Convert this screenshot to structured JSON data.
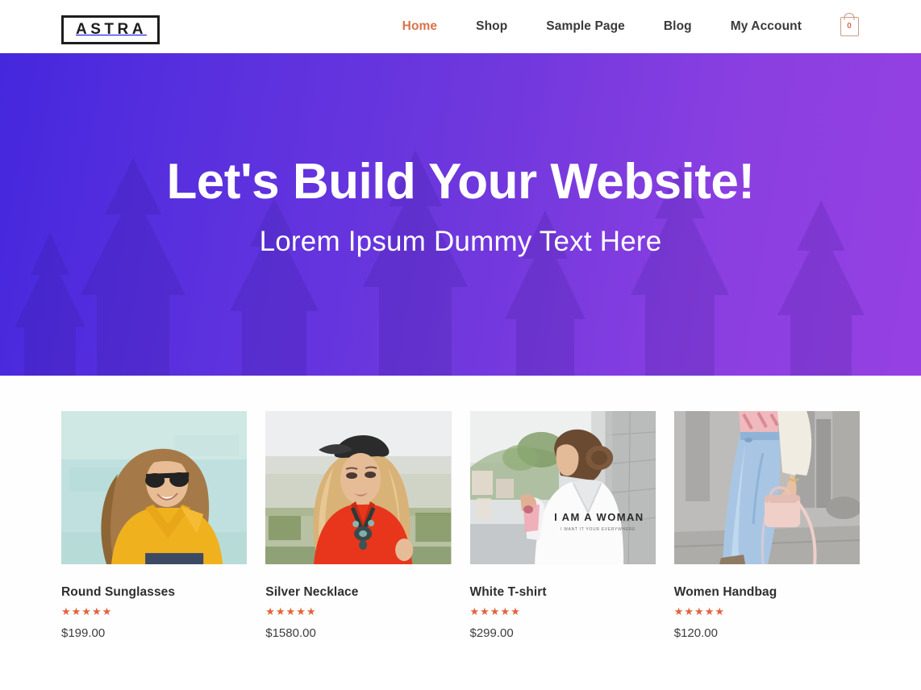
{
  "header": {
    "logo_text": "ASTRA",
    "nav": [
      {
        "label": "Home",
        "active": true
      },
      {
        "label": "Shop",
        "active": false
      },
      {
        "label": "Sample Page",
        "active": false
      },
      {
        "label": "Blog",
        "active": false
      },
      {
        "label": "My Account",
        "active": false
      }
    ],
    "cart": {
      "icon": "shopping-bag-icon",
      "count": "0",
      "color": "#cc9a85"
    }
  },
  "hero": {
    "title": "Let's Build Your Website!",
    "subtitle": "Lorem Ipsum Dummy Text Here",
    "gradient_from": "#4527dd",
    "gradient_to": "#9540e2",
    "background_motif": "pine-tree-silhouettes"
  },
  "products": [
    {
      "name": "Round Sunglasses",
      "stars": "★★★★★",
      "rating": 5,
      "price": "$199.00",
      "image_alt": "woman in yellow polo shirt wearing sunglasses against teal wall"
    },
    {
      "name": "Silver Necklace",
      "stars": "★★★★★",
      "rating": 5,
      "price": "$1580.00",
      "image_alt": "blonde woman in red-orange top with cap and statement necklace"
    },
    {
      "name": "White T-shirt",
      "stars": "★★★★★",
      "rating": 5,
      "price": "$299.00",
      "image_alt": "woman from behind wearing white I AM A WOMAN t-shirt"
    },
    {
      "name": "Women Handbag",
      "stars": "★★★★★",
      "rating": 5,
      "price": "$120.00",
      "image_alt": "woman in light blue jeans holding pink crossbody handbag"
    }
  ],
  "theme": {
    "accent": "#d9724b",
    "star_color": "#e2623c",
    "text_dark": "#2e2e2e"
  }
}
